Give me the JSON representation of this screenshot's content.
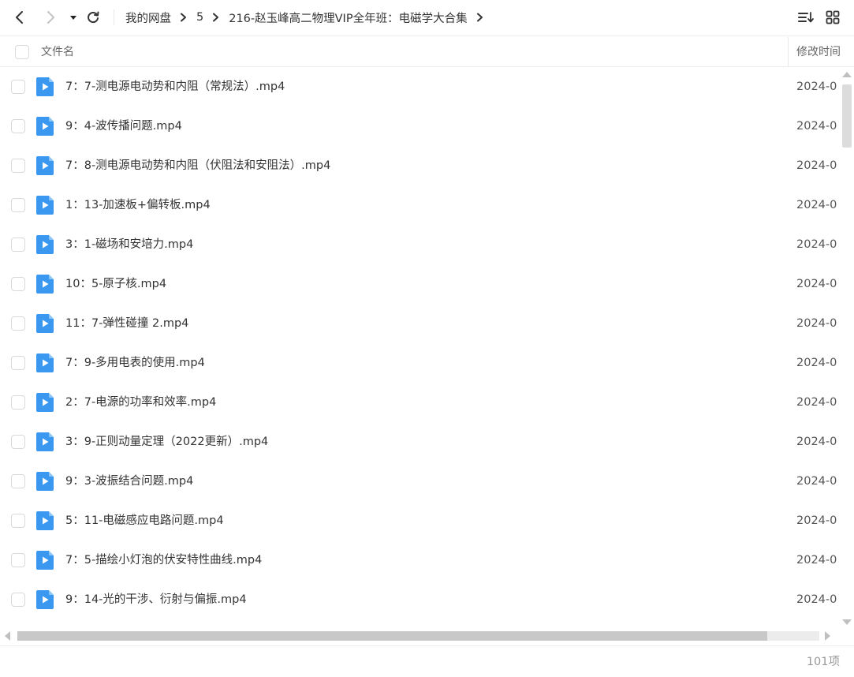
{
  "toolbar": {
    "back_icon": "chevron-left-icon",
    "forward_icon": "chevron-right-icon",
    "history_icon": "caret-down-icon",
    "refresh_icon": "refresh-icon",
    "sort_icon": "sort-list-icon",
    "view_icon": "grid-view-icon"
  },
  "breadcrumb": [
    "我的网盘",
    "5",
    "216-赵玉峰高二物理VIP全年班：电磁学大合集"
  ],
  "header": {
    "name_label": "文件名",
    "time_label": "修改时间"
  },
  "files": [
    {
      "name": "7：7-测电源电动势和内阻（常规法）.mp4",
      "modified": "2024-0",
      "icon": "video-file-icon"
    },
    {
      "name": "9：4-波传播问题.mp4",
      "modified": "2024-0",
      "icon": "video-file-icon"
    },
    {
      "name": "7：8-测电源电动势和内阻（伏阻法和安阻法）.mp4",
      "modified": "2024-0",
      "icon": "video-file-icon"
    },
    {
      "name": "1：13-加速板+偏转板.mp4",
      "modified": "2024-0",
      "icon": "video-file-icon"
    },
    {
      "name": "3：1-磁场和安培力.mp4",
      "modified": "2024-0",
      "icon": "video-file-icon"
    },
    {
      "name": "10：5-原子核.mp4",
      "modified": "2024-0",
      "icon": "video-file-icon"
    },
    {
      "name": "11：7-弹性碰撞 2.mp4",
      "modified": "2024-0",
      "icon": "video-file-icon"
    },
    {
      "name": "7：9-多用电表的使用.mp4",
      "modified": "2024-0",
      "icon": "video-file-icon"
    },
    {
      "name": "2：7-电源的功率和效率.mp4",
      "modified": "2024-0",
      "icon": "video-file-icon"
    },
    {
      "name": "3：9-正则动量定理（2022更新）.mp4",
      "modified": "2024-0",
      "icon": "video-file-icon"
    },
    {
      "name": "9：3-波振结合问题.mp4",
      "modified": "2024-0",
      "icon": "video-file-icon"
    },
    {
      "name": "5：11-电磁感应电路问题.mp4",
      "modified": "2024-0",
      "icon": "video-file-icon"
    },
    {
      "name": "7：5-描绘小灯泡的伏安特性曲线.mp4",
      "modified": "2024-0",
      "icon": "video-file-icon"
    },
    {
      "name": "9：14-光的干涉、衍射与偏振.mp4",
      "modified": "2024-0",
      "icon": "video-file-icon"
    }
  ],
  "status": {
    "item_count": "101项"
  },
  "colors": {
    "file_icon": "#3a98f0",
    "text": "#333333",
    "muted": "#999999"
  }
}
